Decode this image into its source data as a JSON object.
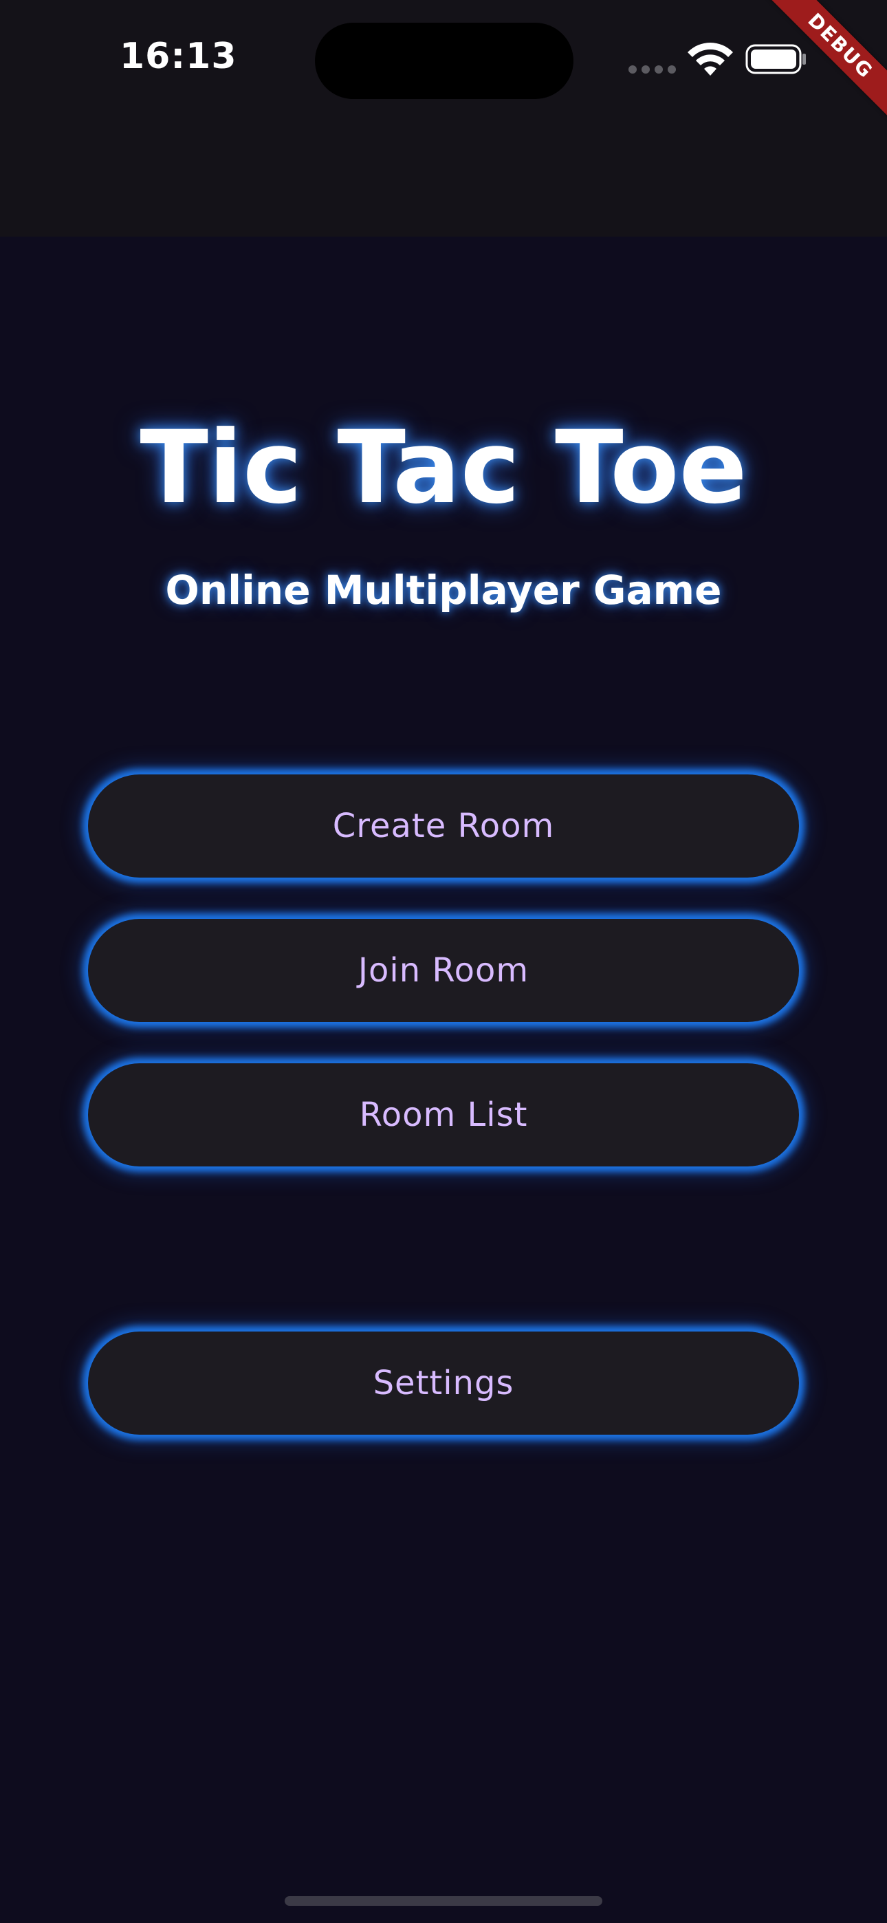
{
  "status_bar": {
    "time": "16:13",
    "icons": [
      "signal-dots-icon",
      "wifi-icon",
      "battery-icon"
    ]
  },
  "debug_banner": {
    "label": "DEBUG",
    "color": "#9e1c1c"
  },
  "header": {
    "title": "Tic Tac Toe",
    "subtitle": "Online Multiplayer Game"
  },
  "menu": {
    "create_room_label": "Create Room",
    "join_room_label": "Join Room",
    "room_list_label": "Room List",
    "settings_label": "Settings"
  },
  "colors": {
    "background": "#0e0c1e",
    "status_bar_bg": "#141218",
    "button_bg": "#1d1b21",
    "button_text": "#d8bbff",
    "glow": "#1e82ff"
  }
}
